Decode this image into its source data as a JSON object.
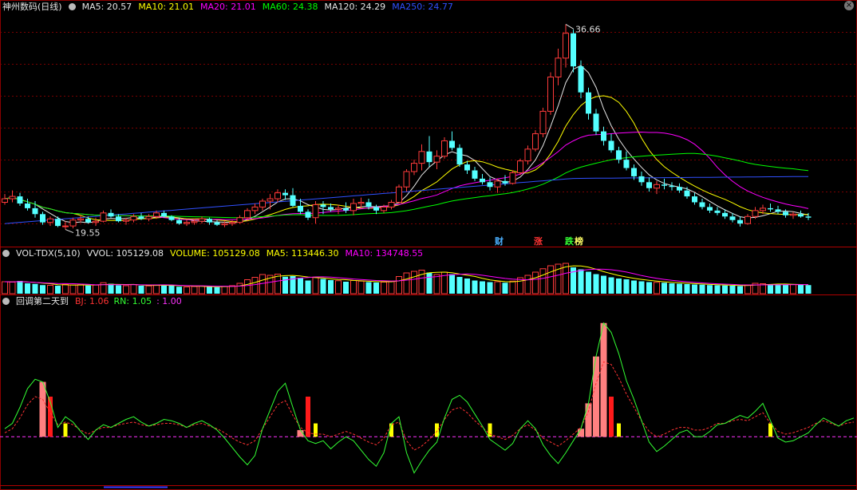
{
  "stock": {
    "title": "神州数码(日线)"
  },
  "price_panel": {
    "legend": [
      {
        "label": "MA5: 20.57",
        "color": "#e6e6e6"
      },
      {
        "label": "MA10: 21.01",
        "color": "#ffff00"
      },
      {
        "label": "MA20: 21.01",
        "color": "#ff00ff"
      },
      {
        "label": "MA60: 24.38",
        "color": "#00ff00"
      },
      {
        "label": "MA120: 24.29",
        "color": "#e6e6e6"
      },
      {
        "label": "MA250: 24.77",
        "color": "#3050ff"
      }
    ],
    "high_label": "36.66",
    "low_label": "19.55",
    "flags": [
      {
        "text": "财",
        "color": "#4ab0ff"
      },
      {
        "text": "涨",
        "color": "#ff3333"
      },
      {
        "text": "跌",
        "color": "#33ff33"
      },
      {
        "text": "榜",
        "color": "#ffff66"
      }
    ]
  },
  "volume_panel": {
    "title": "VOL-TDX(5,10)",
    "legend": [
      {
        "label": "VVOL: 105129.08",
        "color": "#e6e6e6"
      },
      {
        "label": "VOLUME: 105129.08",
        "color": "#ffff00"
      },
      {
        "label": "MA5: 113446.30",
        "color": "#ffff00"
      },
      {
        "label": "MA10: 134748.55",
        "color": "#ff00ff"
      }
    ]
  },
  "indicator_panel": {
    "title": "回调第二天到",
    "legend": [
      {
        "label": "BJ: 1.06",
        "color": "#ff3333"
      },
      {
        "label": "RN: 1.05",
        "color": "#33ff33"
      },
      {
        "label": ": 1.00",
        "color": "#ff33ff"
      }
    ]
  },
  "chart_data": [
    {
      "type": "candlestick",
      "ylim": [
        19,
        37.5
      ],
      "up_color": "#ff3b3b",
      "down_color": "#54ffff",
      "candles": [
        [
          21.6,
          22.3,
          21.4,
          21.9
        ],
        [
          21.9,
          22.6,
          21.6,
          22.1
        ],
        [
          22.1,
          22.4,
          21.3,
          21.5
        ],
        [
          21.5,
          21.9,
          20.9,
          21.1
        ],
        [
          21.1,
          21.7,
          20.3,
          20.6
        ],
        [
          20.6,
          20.8,
          19.7,
          19.9
        ],
        [
          19.9,
          20.4,
          19.6,
          20.2
        ],
        [
          20.2,
          20.4,
          19.5,
          19.6
        ],
        [
          19.6,
          20.0,
          19.3,
          19.6
        ],
        [
          19.6,
          20.3,
          19.4,
          20.1
        ],
        [
          20.1,
          20.5,
          19.9,
          20.2
        ],
        [
          20.2,
          20.4,
          19.8,
          19.9
        ],
        [
          19.9,
          20.3,
          19.6,
          20.0
        ],
        [
          20.0,
          20.9,
          19.9,
          20.7
        ],
        [
          20.7,
          21.0,
          20.3,
          20.4
        ],
        [
          20.4,
          20.6,
          19.9,
          20.0
        ],
        [
          20.0,
          20.3,
          19.7,
          20.1
        ],
        [
          20.1,
          20.6,
          19.9,
          20.4
        ],
        [
          20.4,
          20.7,
          20.1,
          20.2
        ],
        [
          20.2,
          20.6,
          20.0,
          20.4
        ],
        [
          20.4,
          20.9,
          20.2,
          20.7
        ],
        [
          20.7,
          20.9,
          20.3,
          20.4
        ],
        [
          20.4,
          20.5,
          20.0,
          20.1
        ],
        [
          20.1,
          20.3,
          19.7,
          19.8
        ],
        [
          19.8,
          20.1,
          19.6,
          19.9
        ],
        [
          19.9,
          20.2,
          19.7,
          20.0
        ],
        [
          20.0,
          20.4,
          19.8,
          20.2
        ],
        [
          20.2,
          20.3,
          19.7,
          19.9
        ],
        [
          19.9,
          20.1,
          19.6,
          19.7
        ],
        [
          19.7,
          20.0,
          19.5,
          19.8
        ],
        [
          19.8,
          20.1,
          19.6,
          19.9
        ],
        [
          19.9,
          20.5,
          19.8,
          20.3
        ],
        [
          20.3,
          21.1,
          20.0,
          20.9
        ],
        [
          20.9,
          21.5,
          20.6,
          21.2
        ],
        [
          21.2,
          21.9,
          20.9,
          21.7
        ],
        [
          21.7,
          22.3,
          21.0,
          21.9
        ],
        [
          21.9,
          22.7,
          21.6,
          22.4
        ],
        [
          22.4,
          22.7,
          21.8,
          22.2
        ],
        [
          22.2,
          22.8,
          21.2,
          21.3
        ],
        [
          21.3,
          21.9,
          20.6,
          20.8
        ],
        [
          20.8,
          21.0,
          20.1,
          20.3
        ],
        [
          20.3,
          21.7,
          19.8,
          21.4
        ],
        [
          21.4,
          21.7,
          20.6,
          21.2
        ],
        [
          21.2,
          21.5,
          20.8,
          21.0
        ],
        [
          21.0,
          21.4,
          20.6,
          21.1
        ],
        [
          21.1,
          21.6,
          20.7,
          20.9
        ],
        [
          20.9,
          21.9,
          20.5,
          21.5
        ],
        [
          21.5,
          22.0,
          21.1,
          21.6
        ],
        [
          21.6,
          21.9,
          21.0,
          21.2
        ],
        [
          21.2,
          21.4,
          20.6,
          20.9
        ],
        [
          20.9,
          21.4,
          20.7,
          21.2
        ],
        [
          21.2,
          21.8,
          21.0,
          21.6
        ],
        [
          21.6,
          23.1,
          21.5,
          22.9
        ],
        [
          22.9,
          24.4,
          22.5,
          24.2
        ],
        [
          24.2,
          25.2,
          23.9,
          24.9
        ],
        [
          24.9,
          26.5,
          24.3,
          25.9
        ],
        [
          25.9,
          27.2,
          24.6,
          25.0
        ],
        [
          25.0,
          26.0,
          24.4,
          25.5
        ],
        [
          25.5,
          27.1,
          25.3,
          26.8
        ],
        [
          26.8,
          27.6,
          26.0,
          26.2
        ],
        [
          26.2,
          26.5,
          24.6,
          24.8
        ],
        [
          24.8,
          25.1,
          24.0,
          24.3
        ],
        [
          24.3,
          24.6,
          23.4,
          23.6
        ],
        [
          23.6,
          24.0,
          23.1,
          23.3
        ],
        [
          23.3,
          23.7,
          22.6,
          22.9
        ],
        [
          22.9,
          23.6,
          22.4,
          23.4
        ],
        [
          23.4,
          23.9,
          23.0,
          23.2
        ],
        [
          23.2,
          24.3,
          23.1,
          24.1
        ],
        [
          24.1,
          25.3,
          23.9,
          25.1
        ],
        [
          25.1,
          26.4,
          24.8,
          26.1
        ],
        [
          26.1,
          27.7,
          25.9,
          27.4
        ],
        [
          27.4,
          29.6,
          27.1,
          29.3
        ],
        [
          29.3,
          32.6,
          29.0,
          32.2
        ],
        [
          32.2,
          34.6,
          31.5,
          33.8
        ],
        [
          33.8,
          36.66,
          33.0,
          35.9
        ],
        [
          35.9,
          36.2,
          32.6,
          33.1
        ],
        [
          33.1,
          33.6,
          30.4,
          30.9
        ],
        [
          30.9,
          31.3,
          28.6,
          29.1
        ],
        [
          29.1,
          29.5,
          27.3,
          27.6
        ],
        [
          27.6,
          28.0,
          26.4,
          26.8
        ],
        [
          26.8,
          27.4,
          25.8,
          26.0
        ],
        [
          26.0,
          26.3,
          24.9,
          25.2
        ],
        [
          25.2,
          25.9,
          24.3,
          24.5
        ],
        [
          24.5,
          24.8,
          23.5,
          23.8
        ],
        [
          23.8,
          24.2,
          23.0,
          23.3
        ],
        [
          23.3,
          23.7,
          22.5,
          22.8
        ],
        [
          22.8,
          23.4,
          22.3,
          23.1
        ],
        [
          23.1,
          23.6,
          22.7,
          23.0
        ],
        [
          23.0,
          23.3,
          22.6,
          22.9
        ],
        [
          22.9,
          23.2,
          22.4,
          22.6
        ],
        [
          22.6,
          22.9,
          21.9,
          22.1
        ],
        [
          22.1,
          22.4,
          21.4,
          21.6
        ],
        [
          21.6,
          21.9,
          21.0,
          21.2
        ],
        [
          21.2,
          21.5,
          20.7,
          20.9
        ],
        [
          20.9,
          21.2,
          20.5,
          20.7
        ],
        [
          20.7,
          21.0,
          20.2,
          20.4
        ],
        [
          20.4,
          20.7,
          19.9,
          20.1
        ],
        [
          20.1,
          20.4,
          19.55,
          19.8
        ],
        [
          19.8,
          20.6,
          19.7,
          20.4
        ],
        [
          20.4,
          21.2,
          20.2,
          20.9
        ],
        [
          20.9,
          21.4,
          20.6,
          21.1
        ],
        [
          21.1,
          21.5,
          20.8,
          21.0
        ],
        [
          21.0,
          21.3,
          20.6,
          20.8
        ],
        [
          20.8,
          21.0,
          20.3,
          20.5
        ],
        [
          20.5,
          20.8,
          20.2,
          20.6
        ],
        [
          20.6,
          20.9,
          20.3,
          20.4
        ],
        [
          20.4,
          20.7,
          20.1,
          20.3
        ]
      ]
    },
    {
      "type": "bar",
      "values": [
        60,
        58,
        64,
        52,
        49,
        43,
        42,
        40,
        47,
        44,
        45,
        41,
        43,
        55,
        50,
        42,
        40,
        46,
        40,
        39,
        44,
        43,
        41,
        35,
        34,
        36,
        38,
        35,
        33,
        36,
        40,
        52,
        70,
        82,
        96,
        92,
        98,
        85,
        88,
        80,
        66,
        83,
        74,
        68,
        65,
        60,
        66,
        63,
        58,
        56,
        58,
        63,
        86,
        104,
        112,
        118,
        106,
        96,
        108,
        98,
        84,
        76,
        66,
        62,
        58,
        60,
        55,
        63,
        80,
        92,
        108,
        125,
        140,
        148,
        152,
        132,
        122,
        110,
        98,
        90,
        82,
        76,
        72,
        66,
        62,
        58,
        57,
        55,
        52,
        50,
        48,
        46,
        45,
        43,
        42,
        41,
        40,
        38,
        44,
        52,
        50,
        48,
        47,
        45,
        46,
        44,
        43
      ],
      "ylim": [
        0,
        160
      ]
    },
    {
      "type": "line",
      "series": [
        {
          "name": "RN",
          "values": [
            1.06,
            1.1,
            1.22,
            1.36,
            1.43,
            1.41,
            1.26,
            1.07,
            1.15,
            1.11,
            1.04,
            0.98,
            1.05,
            1.09,
            1.07,
            1.1,
            1.13,
            1.15,
            1.11,
            1.08,
            1.1,
            1.13,
            1.12,
            1.1,
            1.07,
            1.1,
            1.12,
            1.09,
            1.05,
            0.99,
            0.92,
            0.85,
            0.79,
            0.86,
            1.06,
            1.2,
            1.34,
            1.4,
            1.22,
            1.05,
            0.97,
            0.95,
            0.97,
            0.91,
            0.96,
            1.0,
            0.97,
            0.9,
            0.83,
            0.78,
            0.88,
            1.1,
            1.15,
            0.88,
            0.73,
            0.82,
            0.9,
            0.96,
            1.14,
            1.28,
            1.31,
            1.26,
            1.17,
            1.08,
            0.98,
            0.94,
            0.9,
            0.95,
            1.06,
            1.12,
            1.06,
            0.94,
            0.86,
            0.8,
            0.88,
            0.97,
            1.06,
            1.25,
            1.6,
            1.85,
            1.78,
            1.62,
            1.42,
            1.28,
            1.12,
            0.96,
            0.89,
            0.93,
            0.98,
            1.03,
            1.05,
            1.0,
            1.0,
            1.04,
            1.09,
            1.1,
            1.13,
            1.16,
            1.14,
            1.19,
            1.25,
            1.12,
            0.99,
            0.96,
            0.97,
            1.0,
            1.03,
            1.09,
            1.14,
            1.11,
            1.08,
            1.12,
            1.14
          ]
        },
        {
          "name": "BJ",
          "values": [
            1.03,
            1.06,
            1.14,
            1.24,
            1.3,
            1.28,
            1.18,
            1.09,
            1.11,
            1.09,
            1.05,
            1.02,
            1.05,
            1.07,
            1.07,
            1.09,
            1.1,
            1.11,
            1.09,
            1.08,
            1.09,
            1.1,
            1.1,
            1.09,
            1.07,
            1.09,
            1.1,
            1.08,
            1.06,
            1.03,
            0.99,
            0.96,
            0.94,
            0.97,
            1.06,
            1.15,
            1.24,
            1.27,
            1.16,
            1.07,
            1.03,
            1.02,
            1.02,
            1.0,
            1.02,
            1.04,
            1.02,
            0.99,
            0.96,
            0.94,
            0.99,
            1.09,
            1.11,
            0.97,
            0.9,
            0.93,
            0.98,
            1.04,
            1.13,
            1.2,
            1.22,
            1.18,
            1.12,
            1.07,
            1.02,
            1.0,
            0.98,
            1.01,
            1.06,
            1.09,
            1.05,
            0.99,
            0.96,
            0.93,
            0.97,
            1.02,
            1.07,
            1.19,
            1.4,
            1.56,
            1.54,
            1.44,
            1.32,
            1.22,
            1.12,
            1.04,
            1.0,
            1.02,
            1.05,
            1.07,
            1.07,
            1.05,
            1.05,
            1.07,
            1.1,
            1.1,
            1.12,
            1.13,
            1.12,
            1.15,
            1.18,
            1.1,
            1.04,
            1.02,
            1.03,
            1.05,
            1.07,
            1.1,
            1.12,
            1.1,
            1.08,
            1.1,
            1.11
          ]
        }
      ],
      "baseline": 1.0,
      "ylim": [
        0.65,
        1.95
      ]
    }
  ]
}
